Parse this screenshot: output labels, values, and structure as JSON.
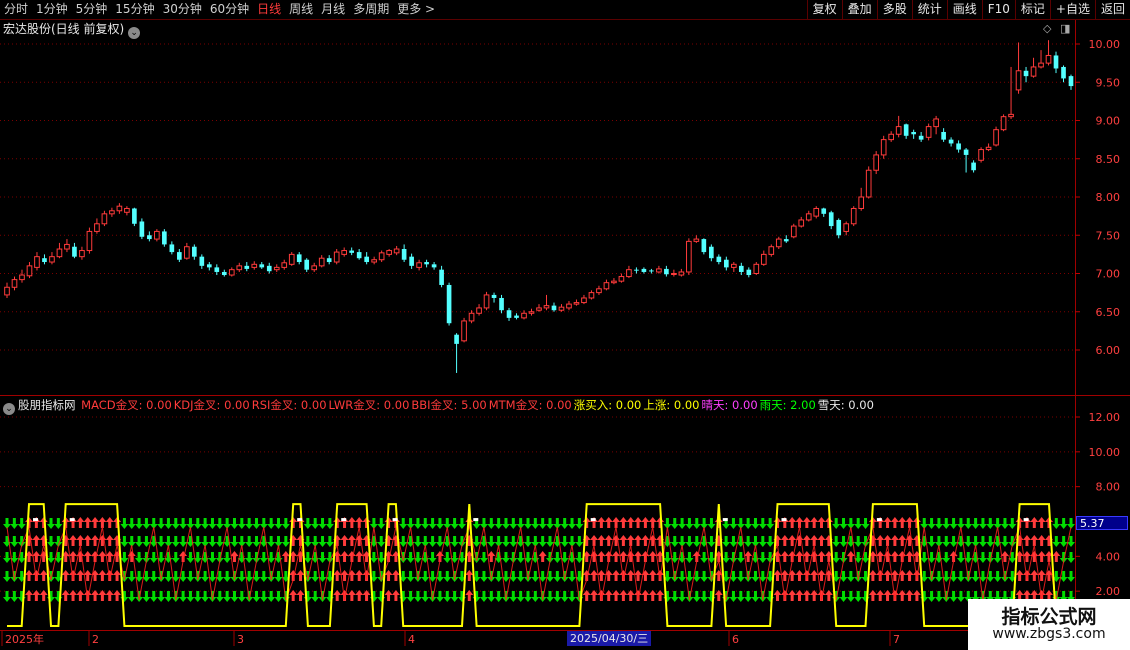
{
  "toolbar": {
    "periods": [
      "分时",
      "1分钟",
      "5分钟",
      "15分钟",
      "30分钟",
      "60分钟",
      "日线",
      "周线",
      "月线",
      "多周期",
      "更多 >"
    ],
    "active_period": "日线",
    "tools": [
      "复权",
      "叠加",
      "多股",
      "统计",
      "画线",
      "F10",
      "标记",
      "+自选",
      "返回"
    ]
  },
  "stock": {
    "title": "宏达股份(日线 前复权)",
    "price_axis": [
      "10.00",
      "9.50",
      "9.00",
      "8.50",
      "8.00",
      "7.50",
      "7.00",
      "6.50",
      "6.00"
    ]
  },
  "indicator": {
    "name": "股朋指标网",
    "legend": [
      {
        "label": "MACD金叉:",
        "value": "0.00",
        "color": "#ff3b3b"
      },
      {
        "label": "KDJ金叉:",
        "value": "0.00",
        "color": "#ff3b3b"
      },
      {
        "label": "RSI金叉:",
        "value": "0.00",
        "color": "#ff3b3b"
      },
      {
        "label": "LWR金叉:",
        "value": "0.00",
        "color": "#ff3b3b"
      },
      {
        "label": "BBI金叉:",
        "value": "5.00",
        "color": "#ff3b3b"
      },
      {
        "label": "MTM金叉:",
        "value": "0.00",
        "color": "#ff3b3b"
      },
      {
        "label": "涨买入:",
        "value": "0.00",
        "color": "#ffff00"
      },
      {
        "label": "上涨:",
        "value": "0.00",
        "color": "#ffff00"
      },
      {
        "label": "晴天:",
        "value": "0.00",
        "color": "#ff40ff"
      },
      {
        "label": "雨天:",
        "value": "2.00",
        "color": "#00ff00"
      },
      {
        "label": "雪天:",
        "value": "0.00",
        "color": "#e8e8e8"
      }
    ],
    "axis": [
      "12.00",
      "10.00",
      "8.00",
      "4.00",
      "2.00"
    ],
    "current_value": "5.37"
  },
  "time_axis": {
    "labels": [
      "2025年",
      "2",
      "3",
      "4",
      "6",
      "7"
    ],
    "crosshair_date": "2025/04/30/三"
  },
  "watermark": {
    "line1": "指标公式网",
    "line2": "www.zbgs3.com"
  },
  "colors": {
    "up": "#ff3b3b",
    "down": "#54ffff",
    "grid": "#7a0000",
    "signal_line": "#ffff00",
    "down_arrow": "#00dd00"
  },
  "chart_data": [
    {
      "type": "candlestick",
      "title": "宏达股份(日线 前复权)",
      "ylim": [
        5.5,
        10.2
      ],
      "open": [
        6.72,
        6.82,
        6.92,
        6.97,
        7.08,
        7.2,
        7.15,
        7.22,
        7.32,
        7.35,
        7.22,
        7.3,
        7.55,
        7.65,
        7.78,
        7.82,
        7.8,
        7.85,
        7.68,
        7.5,
        7.45,
        7.55,
        7.38,
        7.28,
        7.2,
        7.35,
        7.22,
        7.12,
        7.08,
        7.02,
        6.98,
        7.05,
        7.1,
        7.08,
        7.12,
        7.1,
        7.05,
        7.08,
        7.12,
        7.25,
        7.18,
        7.05,
        7.1,
        7.2,
        7.15,
        7.25,
        7.3,
        7.28,
        7.22,
        7.15,
        7.18,
        7.25,
        7.27,
        7.32,
        7.22,
        7.08,
        7.15,
        7.12,
        7.05,
        6.85,
        6.2,
        6.12,
        6.38,
        6.48,
        6.55,
        6.72,
        6.68,
        6.52,
        6.45,
        6.42,
        6.48,
        6.52,
        6.55,
        6.58,
        6.52,
        6.55,
        6.6,
        6.62,
        6.68,
        6.75,
        6.8,
        6.88,
        6.9,
        6.96,
        7.05,
        7.06,
        7.04,
        7.02,
        7.06,
        6.99,
        6.98,
        7.02,
        7.42,
        7.45,
        7.35,
        7.22,
        7.18,
        7.08,
        7.1,
        7.05,
        7.0,
        7.12,
        7.25,
        7.35,
        7.45,
        7.48,
        7.62,
        7.7,
        7.75,
        7.85,
        7.8,
        7.7,
        7.55,
        7.65,
        7.85,
        8.0,
        8.35,
        8.55,
        8.75,
        8.82,
        8.95,
        8.85,
        8.8,
        8.78,
        8.92,
        8.85,
        8.75,
        8.7,
        8.62,
        8.45,
        8.48,
        8.62,
        8.68,
        8.88,
        9.05,
        9.4,
        9.65,
        9.58,
        9.7,
        9.75,
        9.85,
        9.7,
        9.58
      ],
      "close": [
        6.82,
        6.92,
        6.98,
        7.1,
        7.22,
        7.15,
        7.22,
        7.32,
        7.38,
        7.22,
        7.3,
        7.55,
        7.65,
        7.78,
        7.82,
        7.88,
        7.85,
        7.65,
        7.48,
        7.45,
        7.55,
        7.38,
        7.28,
        7.18,
        7.35,
        7.22,
        7.1,
        7.08,
        7.02,
        6.98,
        7.05,
        7.1,
        7.06,
        7.12,
        7.08,
        7.03,
        7.08,
        7.14,
        7.25,
        7.15,
        7.05,
        7.1,
        7.2,
        7.15,
        7.28,
        7.3,
        7.27,
        7.2,
        7.15,
        7.18,
        7.27,
        7.3,
        7.32,
        7.18,
        7.1,
        7.14,
        7.12,
        7.08,
        6.85,
        6.35,
        6.08,
        6.38,
        6.48,
        6.55,
        6.72,
        6.68,
        6.52,
        6.42,
        6.42,
        6.48,
        6.5,
        6.55,
        6.58,
        6.52,
        6.56,
        6.6,
        6.62,
        6.68,
        6.75,
        6.8,
        6.88,
        6.9,
        6.96,
        7.05,
        7.04,
        7.02,
        7.03,
        7.06,
        6.99,
        7.0,
        7.02,
        7.42,
        7.45,
        7.28,
        7.2,
        7.15,
        7.08,
        7.12,
        7.02,
        6.98,
        7.12,
        7.25,
        7.35,
        7.45,
        7.42,
        7.62,
        7.7,
        7.78,
        7.85,
        7.78,
        7.62,
        7.5,
        7.65,
        7.85,
        8.0,
        8.35,
        8.55,
        8.75,
        8.82,
        8.92,
        8.8,
        8.82,
        8.75,
        8.92,
        9.02,
        8.75,
        8.7,
        8.62,
        8.55,
        8.35,
        8.62,
        8.65,
        8.88,
        9.05,
        9.08,
        9.65,
        9.58,
        9.7,
        9.75,
        9.85,
        9.68,
        9.55,
        9.45
      ],
      "high": [
        6.88,
        6.96,
        7.05,
        7.15,
        7.28,
        7.25,
        7.28,
        7.4,
        7.45,
        7.4,
        7.35,
        7.6,
        7.72,
        7.82,
        7.86,
        7.92,
        7.88,
        7.86,
        7.72,
        7.55,
        7.58,
        7.58,
        7.42,
        7.32,
        7.4,
        7.38,
        7.25,
        7.15,
        7.12,
        7.05,
        7.08,
        7.14,
        7.15,
        7.16,
        7.15,
        7.14,
        7.12,
        7.18,
        7.28,
        7.28,
        7.2,
        7.14,
        7.24,
        7.24,
        7.32,
        7.34,
        7.34,
        7.32,
        7.28,
        7.22,
        7.3,
        7.32,
        7.36,
        7.38,
        7.26,
        7.18,
        7.18,
        7.15,
        7.1,
        6.88,
        6.22,
        6.42,
        6.52,
        6.6,
        6.76,
        6.75,
        6.72,
        6.55,
        6.48,
        6.52,
        6.54,
        6.6,
        6.72,
        6.62,
        6.6,
        6.64,
        6.66,
        6.72,
        6.78,
        6.84,
        6.92,
        6.94,
        7.0,
        7.1,
        7.08,
        7.08,
        7.06,
        7.1,
        7.1,
        7.05,
        7.06,
        7.46,
        7.5,
        7.46,
        7.38,
        7.25,
        7.22,
        7.15,
        7.14,
        7.08,
        7.15,
        7.3,
        7.38,
        7.48,
        7.5,
        7.65,
        7.74,
        7.82,
        7.88,
        7.86,
        7.82,
        7.72,
        7.68,
        7.88,
        8.12,
        8.4,
        8.6,
        8.8,
        8.86,
        9.06,
        8.96,
        8.88,
        8.85,
        8.96,
        9.06,
        8.9,
        8.78,
        8.74,
        8.64,
        8.48,
        8.65,
        8.7,
        8.92,
        9.08,
        9.7,
        10.02,
        9.7,
        9.82,
        9.92,
        10.05,
        9.9,
        9.72,
        9.6
      ],
      "low": [
        6.68,
        6.78,
        6.88,
        6.94,
        7.04,
        7.12,
        7.12,
        7.2,
        7.28,
        7.2,
        7.18,
        7.26,
        7.52,
        7.62,
        7.74,
        7.78,
        7.76,
        7.62,
        7.45,
        7.42,
        7.42,
        7.35,
        7.25,
        7.15,
        7.18,
        7.18,
        7.06,
        7.04,
        6.98,
        6.96,
        6.96,
        7.02,
        7.03,
        7.05,
        7.06,
        7.0,
        7.02,
        7.05,
        7.1,
        7.12,
        7.02,
        7.02,
        7.08,
        7.12,
        7.12,
        7.22,
        7.24,
        7.18,
        7.12,
        7.12,
        7.15,
        7.22,
        7.24,
        7.15,
        7.06,
        7.04,
        7.08,
        7.05,
        6.82,
        6.32,
        5.7,
        6.1,
        6.35,
        6.45,
        6.52,
        6.62,
        6.48,
        6.38,
        6.4,
        6.4,
        6.45,
        6.5,
        6.52,
        6.5,
        6.5,
        6.52,
        6.58,
        6.6,
        6.66,
        6.72,
        6.78,
        6.86,
        6.88,
        6.94,
        7.0,
        7.0,
        7.0,
        7.0,
        6.96,
        6.96,
        6.96,
        6.98,
        7.4,
        7.25,
        7.16,
        7.12,
        7.04,
        7.02,
        6.98,
        6.95,
        6.98,
        7.1,
        7.22,
        7.32,
        7.4,
        7.46,
        7.6,
        7.68,
        7.72,
        7.74,
        7.58,
        7.46,
        7.5,
        7.62,
        7.82,
        7.98,
        8.3,
        8.5,
        8.72,
        8.78,
        8.76,
        8.76,
        8.72,
        8.74,
        8.82,
        8.72,
        8.66,
        8.58,
        8.32,
        8.32,
        8.45,
        8.6,
        8.66,
        8.86,
        9.02,
        9.35,
        9.5,
        9.56,
        9.68,
        9.72,
        9.62,
        9.5,
        9.4
      ]
    },
    {
      "type": "line",
      "title": "股朋指标网",
      "ylim": [
        0,
        13
      ],
      "series": [
        {
          "name": "涨买入",
          "values": [
            0,
            0,
            0,
            7,
            7,
            7,
            0,
            0,
            7,
            7,
            7,
            7,
            7,
            7,
            7,
            7,
            0,
            0,
            0,
            0,
            0,
            0,
            0,
            0,
            0,
            0,
            0,
            0,
            0,
            0,
            0,
            0,
            0,
            0,
            0,
            0,
            0,
            0,
            0,
            7,
            7,
            0,
            0,
            0,
            0,
            7,
            7,
            7,
            7,
            7,
            0,
            0,
            7,
            7,
            0,
            0,
            0,
            0,
            0,
            0,
            0,
            0,
            0,
            7,
            0,
            0,
            0,
            0,
            0,
            0,
            0,
            0,
            0,
            0,
            0,
            0,
            0,
            0,
            0,
            7,
            7,
            7,
            7,
            7,
            7,
            7,
            7,
            7,
            7,
            7,
            0,
            0,
            0,
            0,
            0,
            0,
            0,
            7,
            0,
            0,
            0,
            0,
            0,
            0,
            0,
            7,
            7,
            7,
            7,
            7,
            7,
            7,
            7,
            0,
            0,
            0,
            0,
            0,
            7,
            7,
            7,
            7,
            7,
            7,
            7,
            0,
            0,
            0,
            0,
            0,
            0,
            0,
            0,
            0,
            0,
            0,
            0,
            0,
            7,
            7,
            7,
            7,
            7,
            0,
            0,
            0
          ]
        }
      ]
    }
  ]
}
